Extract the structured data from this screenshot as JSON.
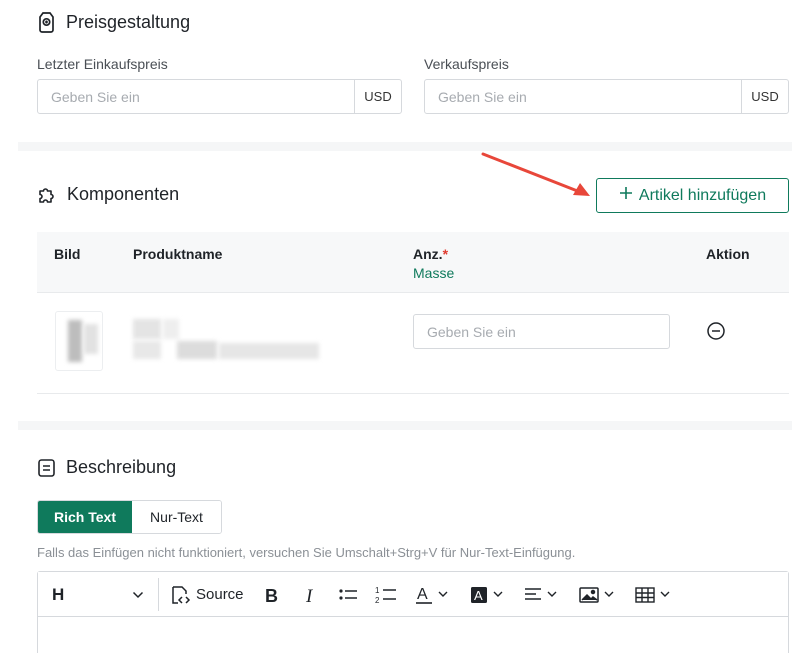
{
  "pricing": {
    "title": "Preisgestaltung",
    "last_purchase_label": "Letzter Einkaufspreis",
    "last_purchase_placeholder": "Geben Sie ein",
    "last_purchase_currency": "USD",
    "sale_label": "Verkaufspreis",
    "sale_placeholder": "Geben Sie ein",
    "sale_currency": "USD"
  },
  "components": {
    "title": "Komponenten",
    "add_button_label": "Artikel hinzufügen",
    "columns": {
      "image": "Bild",
      "product_name": "Produktname",
      "quantity": "Anz.",
      "quantity_required_mark": "*",
      "quantity_unit": "Masse",
      "action": "Aktion"
    },
    "row": {
      "quantity_placeholder": "Geben Sie ein"
    }
  },
  "description": {
    "title": "Beschreibung",
    "tabs": [
      {
        "label": "Rich Text",
        "active": true
      },
      {
        "label": "Nur-Text",
        "active": false
      }
    ],
    "hint": "Falls das Einfügen nicht funktioniert, versuchen Sie Umschalt+Strg+V für Nur-Text-Einfügung.",
    "toolbar": {
      "heading_label": "H",
      "source_label": "Source"
    }
  },
  "colors": {
    "accent": "#0f7a5c",
    "required": "#e03c31",
    "annotation_arrow": "#e8473a"
  },
  "icons": {
    "pricing": "price-tag-icon",
    "components": "puzzle-icon",
    "description": "document-icon",
    "remove": "minus-circle-icon"
  }
}
